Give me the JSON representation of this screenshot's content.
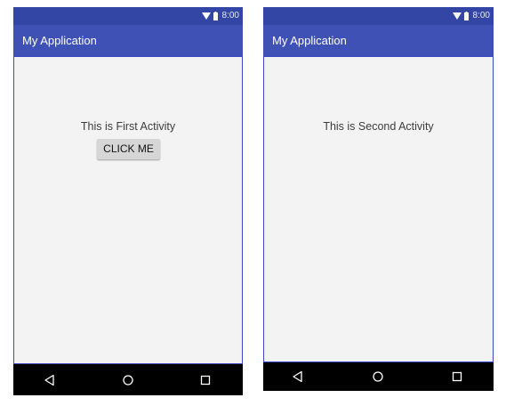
{
  "screens": [
    {
      "status_bar": {
        "time": "8:00",
        "icons": [
          "wifi-icon",
          "battery-icon"
        ]
      },
      "app_bar": {
        "title": "My Application"
      },
      "content": {
        "text": "This is First Activity",
        "button_label": "CLICK ME"
      },
      "nav_bar": {
        "icons": [
          "back-icon",
          "home-icon",
          "recents-icon"
        ]
      }
    },
    {
      "status_bar": {
        "time": "8:00",
        "icons": [
          "wifi-icon",
          "battery-icon"
        ]
      },
      "app_bar": {
        "title": "My Application"
      },
      "content": {
        "text": "This is Second Activity"
      },
      "nav_bar": {
        "icons": [
          "back-icon",
          "home-icon",
          "recents-icon"
        ]
      }
    }
  ],
  "colors": {
    "status_bar": "#3346a6",
    "app_bar": "#3f51b5",
    "content_background": "#f3f3f3",
    "button_background": "#d6d6d6",
    "nav_bar": "#000000"
  }
}
